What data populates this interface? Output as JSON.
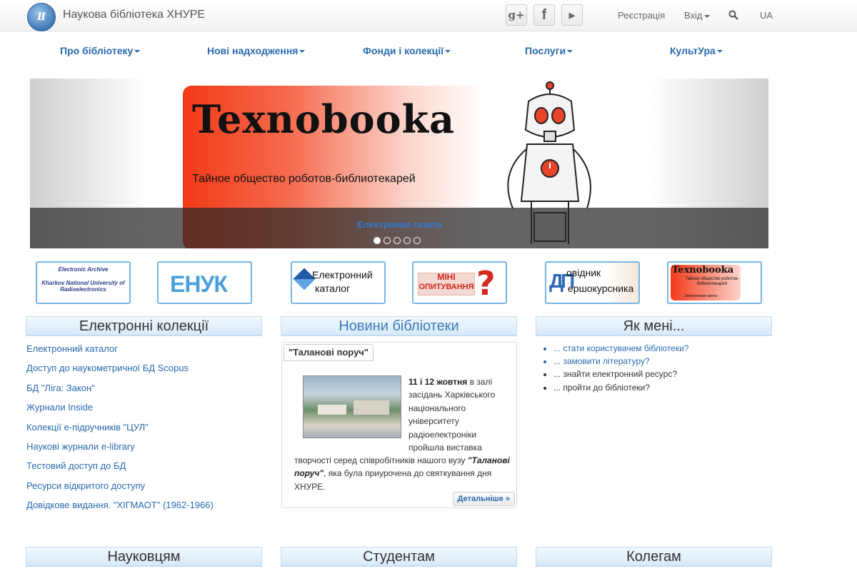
{
  "header": {
    "site_title": "Наукова бібліотека ХНУРЕ",
    "social": {
      "gplus": "g+",
      "facebook": "f",
      "youtube": "▶"
    },
    "register": "Реєстрація",
    "login": "Вхід",
    "lang": "UA"
  },
  "nav": [
    "Про бібліотеку",
    "Нові надходження",
    "Фонди і колекції",
    "Послуги",
    "КультУра"
  ],
  "slider": {
    "title": "Texnobooka",
    "subtitle": "Тайное общество роботов-библиотекарей",
    "caption": "Електронна газета",
    "slides": 5,
    "active_slide": 1
  },
  "tiles": {
    "archive": {
      "line1": "Electronic Archive",
      "line2": "Kharkov National University of Radioelectronics"
    },
    "enuk": "ЕНУК",
    "catalog": {
      "line1": "Електронний",
      "line2": "каталог"
    },
    "survey": {
      "line1": "МІНІ",
      "line2": "ОПИТУВАННЯ"
    },
    "guide": {
      "line1": "овідник",
      "line2": "ершокурсника"
    },
    "texno": {
      "title": "Texnobooka",
      "subtitle": "Тайное общество роботов-библиотекарей",
      "tag": "Электронная газета"
    }
  },
  "sections": {
    "collections": "Електронні колекції",
    "news": "Новини бібліотеки",
    "howto": "Як мені...",
    "scientists": "Науковцям",
    "students": "Студентам",
    "colleagues": "Колегам"
  },
  "collections": [
    "Електронний каталог",
    "Доступ до наукометричної БД Scopus",
    "БД \"Ліга: Закон\"",
    "Журнали Inside",
    "Колекції е-підручників \"ЦУЛ\"",
    "Наукові журнали e-library",
    "Тестовий доступ до БД",
    "Ресурси відкритого доступу",
    "Довідкове видання. \"ХІГМАОТ\" (1962-1966)"
  ],
  "news": {
    "tab": "\"Таланові поруч\"",
    "dates": "11 і 12 жовтня",
    "text1": " в залі засідань Харківського національного університету радіоелектроніки пройшла виставка",
    "text2a": "творчості серед співробітників нашого вузу ",
    "text2b": "\"Таланові поруч\"",
    "text2c": ", яка була приурочена до святкування дня ХНУРЕ.",
    "more": "Детальніше »"
  },
  "howto": [
    {
      "text": "... стати користувачем бібліотеки?",
      "link": true
    },
    {
      "text": "... замовити літературу?",
      "link": true
    },
    {
      "text": "... знайти електронний ресурс?",
      "link": false
    },
    {
      "text": "... пройти до бібліотеки?",
      "link": false
    }
  ],
  "colors": {
    "link": "#2a6aad",
    "tile_border": "#78b5e6",
    "header_bg": "#d8eafa"
  }
}
